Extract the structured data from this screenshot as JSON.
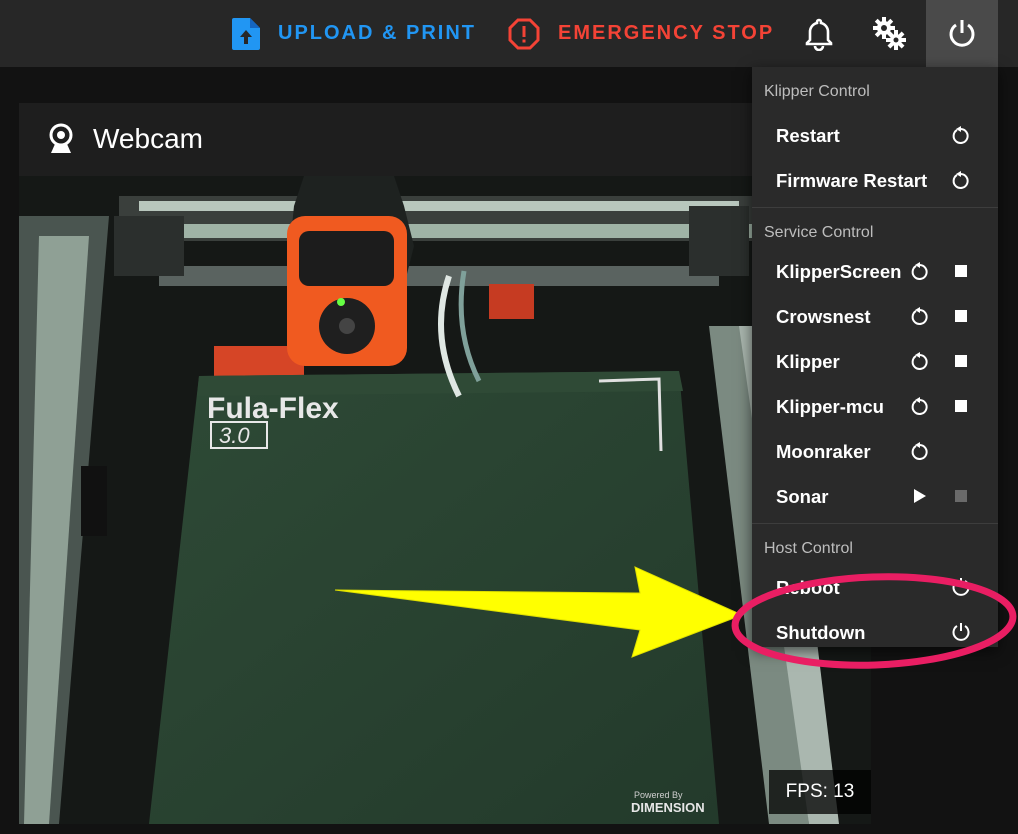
{
  "toolbar": {
    "upload_print": "UPLOAD & PRINT",
    "emergency_stop": "EMERGENCY STOP"
  },
  "webcam": {
    "title": "Webcam",
    "fps": "FPS: 13",
    "bed_brand": "Fula-Flex",
    "bed_version": "3.0",
    "bed_footer_1": "Powered By",
    "bed_footer_2": "DIMENSION"
  },
  "power_menu": {
    "klipper_control": {
      "header": "Klipper Control",
      "items": [
        "Restart",
        "Firmware Restart"
      ]
    },
    "service_control": {
      "header": "Service Control",
      "items": [
        "KlipperScreen",
        "Crowsnest",
        "Klipper",
        "Klipper-mcu",
        "Moonraker",
        "Sonar"
      ]
    },
    "host_control": {
      "header": "Host Control",
      "items": [
        "Reboot",
        "Shutdown"
      ]
    }
  },
  "colors": {
    "upload": "#2196f3",
    "estop": "#f44336",
    "annotation_arrow": "#ffff00",
    "annotation_circle": "#e91e63"
  },
  "icons": [
    "upload-file-icon",
    "alert-octagon-icon",
    "bell-icon",
    "gears-icon",
    "power-icon",
    "webcam-icon",
    "restart-icon",
    "stop-icon",
    "play-icon"
  ]
}
